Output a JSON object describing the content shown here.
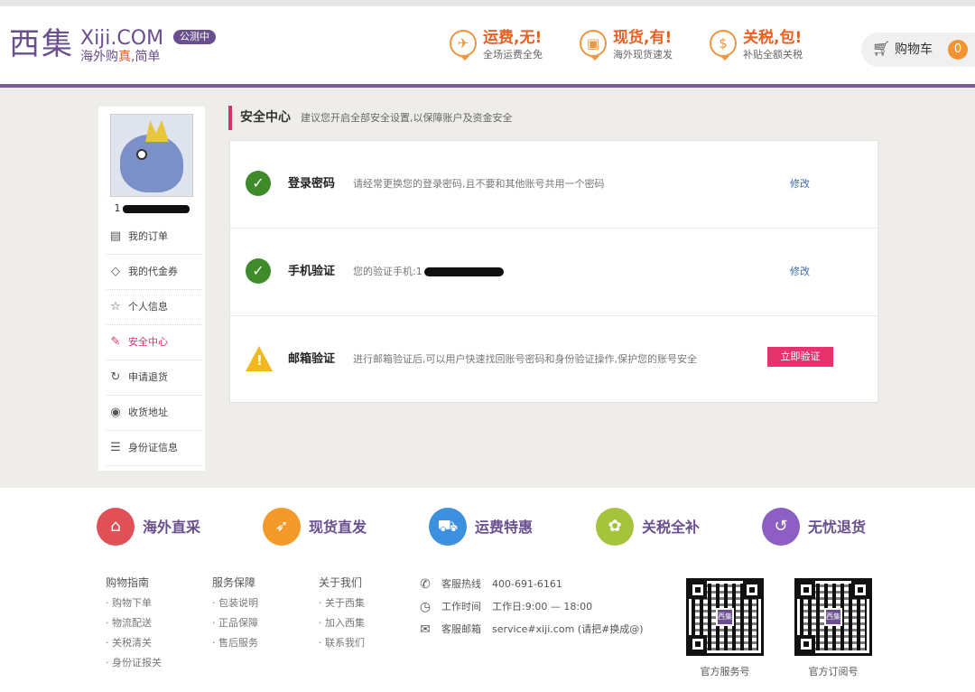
{
  "header": {
    "logo_mark": "西集",
    "logo_text": "Xiji.COM",
    "slogan_prefix": "海外购",
    "slogan_highlight": "真",
    "slogan_suffix": ",简单",
    "beta_badge": "公测中",
    "promos": [
      {
        "icon": "plane-icon",
        "glyph": "✈",
        "title": "运费,无!",
        "subtitle": "全场运费全免"
      },
      {
        "icon": "gift-icon",
        "glyph": "▣",
        "title": "现货,有!",
        "subtitle": "海外现货速发"
      },
      {
        "icon": "coin-icon",
        "glyph": "$",
        "title": "关税,包!",
        "subtitle": "补贴全额关税"
      }
    ],
    "cart": {
      "label": "购物车",
      "count": "0"
    },
    "accent_color": "#7b5a9c"
  },
  "sidebar": {
    "username_prefix": "1",
    "menu": [
      {
        "icon": "document-icon",
        "glyph": "▤",
        "label": "我的订单"
      },
      {
        "icon": "coupon-tag-icon",
        "glyph": "◇",
        "label": "我的代金券"
      },
      {
        "icon": "star-icon",
        "glyph": "☆",
        "label": "个人信息"
      },
      {
        "icon": "edit-icon",
        "glyph": "✎",
        "label": "安全中心",
        "active": true
      },
      {
        "icon": "refresh-icon",
        "glyph": "↻",
        "label": "申请退货"
      },
      {
        "icon": "location-pin-icon",
        "glyph": "◉",
        "label": "收货地址"
      },
      {
        "icon": "id-card-icon",
        "glyph": "☰",
        "label": "身份证信息"
      }
    ]
  },
  "security": {
    "title": "安全中心",
    "description": "建议您开启全部安全设置,以保障账户及资金安全",
    "items": [
      {
        "status": "ok",
        "title": "登录密码",
        "description": "请经常更换您的登录密码,且不要和其他账号共用一个密码",
        "action": "修改"
      },
      {
        "status": "ok",
        "title": "手机验证",
        "description": "您的验证手机:1",
        "action": "修改"
      },
      {
        "status": "warning",
        "title": "邮箱验证",
        "description": "进行邮箱验证后,可以用户快速找回账号密码和身份验证操作,保护您的账号安全",
        "action": "立即验证"
      }
    ]
  },
  "footer": {
    "features": [
      {
        "icon": "shopping-bag-icon",
        "glyph": "⌂",
        "color": "#e14f57",
        "label": "海外直采"
      },
      {
        "icon": "rocket-icon",
        "glyph": "➶",
        "color": "#f39a2a",
        "label": "现货直发"
      },
      {
        "icon": "truck-icon",
        "glyph": "⛟",
        "color": "#3d8fdf",
        "label": "运费特惠"
      },
      {
        "icon": "piggy-bank-icon",
        "glyph": "✿",
        "color": "#a6c33c",
        "label": "关税全补"
      },
      {
        "icon": "return-icon",
        "glyph": "↺",
        "color": "#8d5fc4",
        "label": "无忧退货"
      }
    ],
    "columns": [
      {
        "title": "购物指南",
        "links": [
          "· 购物下单",
          "· 物流配送",
          "· 关税清关",
          "· 身份证报关"
        ]
      },
      {
        "title": "服务保障",
        "links": [
          "· 包装说明",
          "· 正品保障",
          "· 售后服务"
        ]
      },
      {
        "title": "关于我们",
        "links": [
          "· 关于西集",
          "· 加入西集",
          "· 联系我们"
        ]
      }
    ],
    "contact": [
      {
        "icon": "phone-icon",
        "glyph": "✆",
        "label": "客服热线",
        "value": "400-691-6161"
      },
      {
        "icon": "clock-icon",
        "glyph": "◷",
        "label": "工作时间",
        "value": "工作日:9:00 — 18:00"
      },
      {
        "icon": "mail-icon",
        "glyph": "✉",
        "label": "客服邮箱",
        "value": "service#xiji.com (请把#换成@)"
      }
    ],
    "qr_codes": [
      {
        "caption": "官方服务号",
        "logo": "西集"
      },
      {
        "caption": "官方订阅号",
        "logo": "西集"
      }
    ]
  }
}
